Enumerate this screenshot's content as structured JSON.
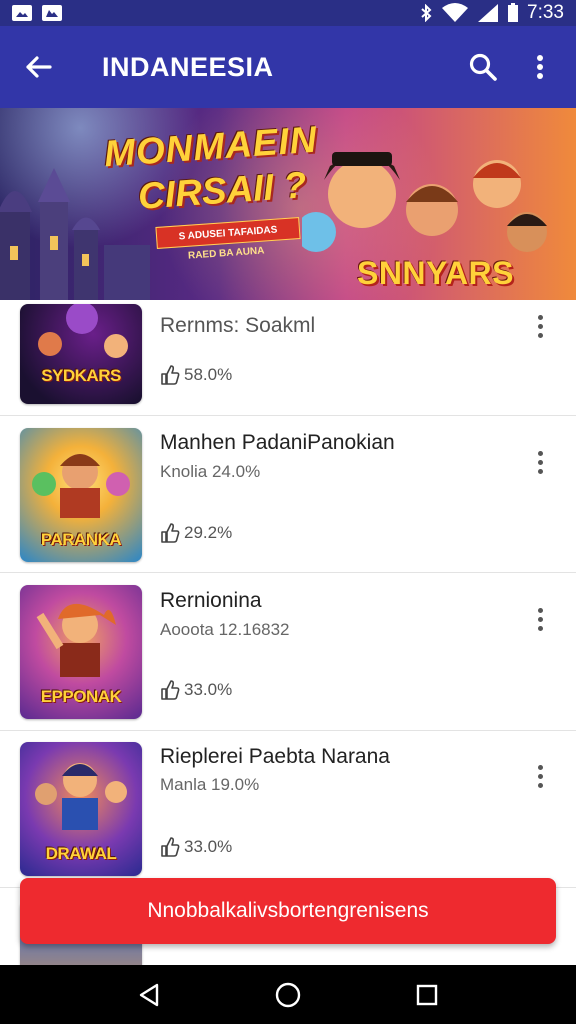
{
  "status_bar": {
    "time": "7:33",
    "icons": [
      "image-icon",
      "gallery-icon",
      "bluetooth-icon",
      "wifi-icon",
      "signal-icon",
      "battery-icon"
    ]
  },
  "app_bar": {
    "title": "INDANEESIA",
    "back_icon": "arrow-left-icon",
    "search_icon": "search-icon",
    "more_icon": "more-vertical-icon",
    "color": "#3236a8"
  },
  "banner": {
    "title_line1": "MONMAEIN",
    "title_line2": "CIRSAII ?",
    "ribbon_text": "S ADUSEI TAFAIDAS",
    "sub_text": "RAED BA AUNA",
    "logo_text": "SNNYARS"
  },
  "list": {
    "items": [
      {
        "title": "Rernms: Soakml",
        "subtitle": "",
        "stat": "58.0%",
        "thumb_label": "SYDKARS",
        "thumb_colors": [
          "#1a1030",
          "#6a1f8a"
        ]
      },
      {
        "title": "Manhen PadaniPanokian",
        "subtitle": "Knolia 24.0%",
        "stat": "29.2%",
        "thumb_label": "PARANKA",
        "thumb_colors": [
          "#f4b13a",
          "#2a86c8"
        ]
      },
      {
        "title": "Rernionina",
        "subtitle": "Aooota 12.16832",
        "stat": "33.0%",
        "thumb_label": "EPPONAK",
        "thumb_colors": [
          "#8a2fb0",
          "#f08a3b"
        ]
      },
      {
        "title": "Rieplerei Paebta Narana",
        "subtitle": "Manla 19.0%",
        "stat": "33.0%",
        "thumb_label": "DRAWAL",
        "thumb_colors": [
          "#3a2fb0",
          "#f0703b"
        ]
      }
    ],
    "stat_icon": "thumb-up-icon",
    "item_more_icon": "more-vertical-icon"
  },
  "cta": {
    "label": "Nnobbalkalivsbortengrenisens",
    "color": "#ee2a2f"
  },
  "nav_bar": {
    "icons": [
      "back-triangle-icon",
      "home-circle-icon",
      "recents-square-icon"
    ]
  }
}
